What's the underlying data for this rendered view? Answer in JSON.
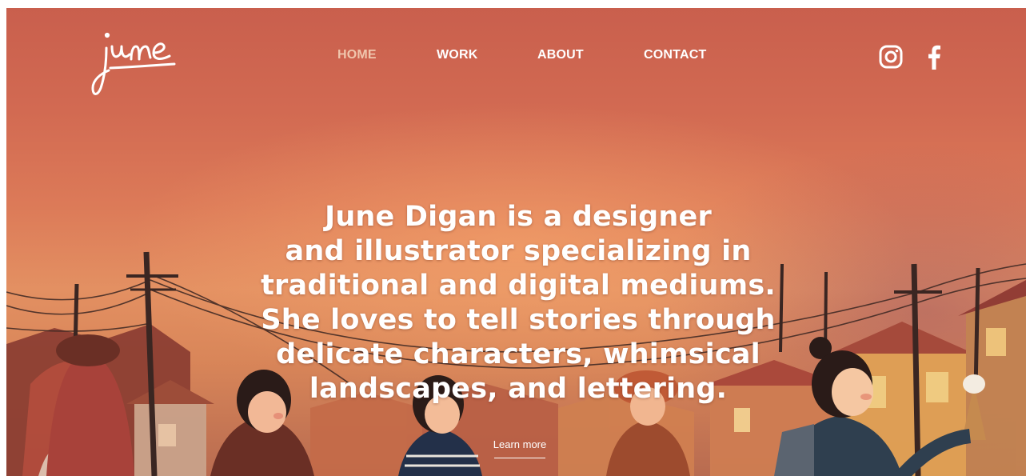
{
  "brand": {
    "logo_text": "june"
  },
  "nav": {
    "items": [
      {
        "label": "HOME",
        "active": true
      },
      {
        "label": "WORK",
        "active": false
      },
      {
        "label": "ABOUT",
        "active": false
      },
      {
        "label": "CONTACT",
        "active": false
      }
    ]
  },
  "social": {
    "icons": [
      "instagram-icon",
      "facebook-icon"
    ]
  },
  "hero": {
    "headline_lines": [
      "June Digan is a designer",
      "and illustrator specializing in",
      "traditional and digital mediums.",
      "She loves to tell stories through",
      "delicate characters, whimsical",
      "landscapes, and lettering."
    ],
    "cta_label": "Learn more"
  },
  "colors": {
    "sky_top": "#c95f4d",
    "sky_mid": "#e39062",
    "nav_active": "#f0c6ad",
    "text": "#ffffff"
  }
}
